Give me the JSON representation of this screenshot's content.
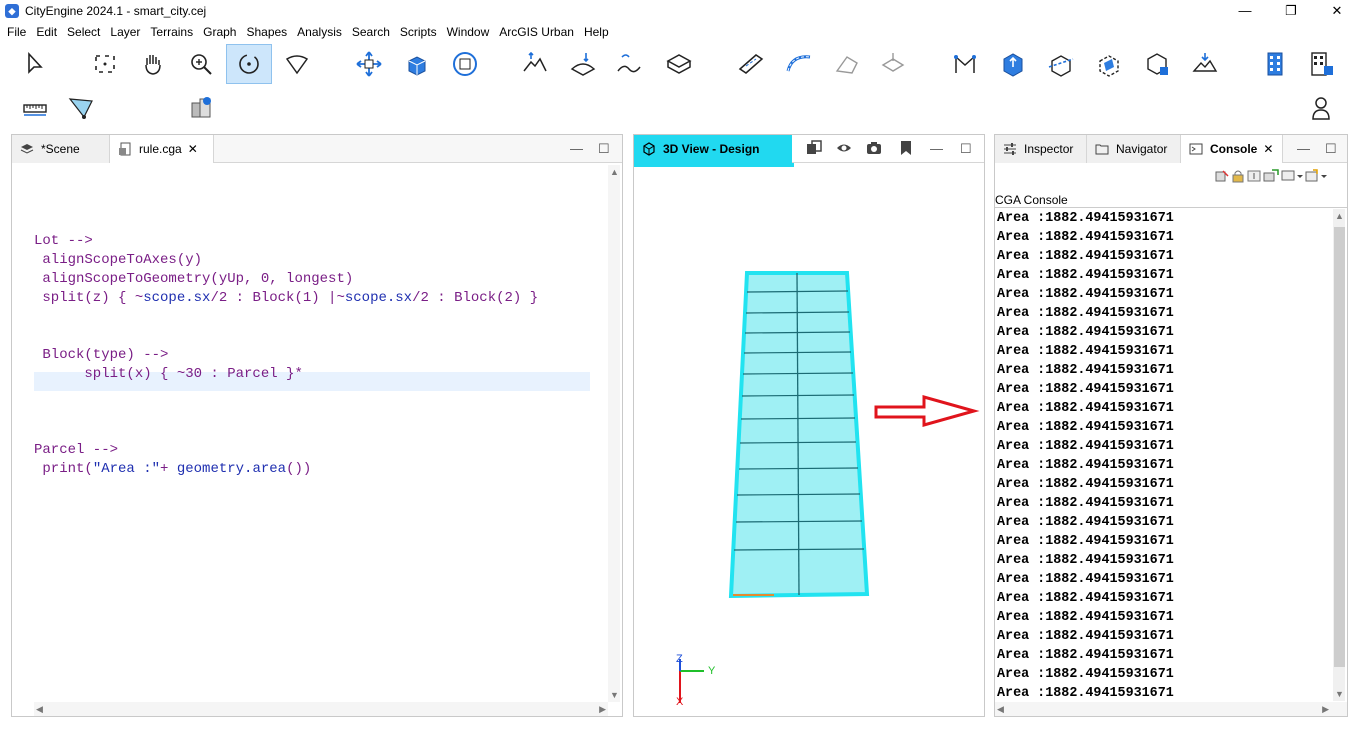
{
  "window": {
    "title": "CityEngine 2024.1 - smart_city.cej",
    "minimize": "—",
    "maximize": "❐",
    "close": "✕"
  },
  "menu": [
    "File",
    "Edit",
    "Select",
    "Layer",
    "Terrains",
    "Graph",
    "Shapes",
    "Analysis",
    "Search",
    "Scripts",
    "Window",
    "ArcGIS Urban",
    "Help"
  ],
  "editor": {
    "tabs": [
      {
        "label": "*Scene",
        "icon": "layers-icon"
      },
      {
        "label": "rule.cga",
        "icon": "rule-file-icon"
      }
    ],
    "code": [
      [
        {
          "t": "",
          "c": "k-dark"
        }
      ],
      [
        {
          "t": "Lot -->",
          "c": "k-purple"
        }
      ],
      [
        {
          "t": " alignScopeToAxes(y)",
          "c": "k-purple"
        }
      ],
      [
        {
          "t": " alignScopeToGeometry(yUp, 0, longest)",
          "c": "k-purple"
        }
      ],
      [
        {
          "t": " split(z) { ~",
          "c": "k-purple"
        },
        {
          "t": "scope.sx",
          "c": "k-blue"
        },
        {
          "t": "/2 : Block(1) |~",
          "c": "k-purple"
        },
        {
          "t": "scope.sx",
          "c": "k-blue"
        },
        {
          "t": "/2 : Block(2) }",
          "c": "k-purple"
        }
      ],
      [
        {
          "t": "",
          "c": "k-dark"
        }
      ],
      [
        {
          "t": "",
          "c": "k-dark"
        }
      ],
      [
        {
          "t": " Block(type) -->",
          "c": "k-purple"
        }
      ],
      [
        {
          "t": "      split(x) { ~30 : Parcel }*",
          "c": "k-purple"
        }
      ],
      [
        {
          "t": "",
          "c": "k-dark"
        }
      ],
      [
        {
          "t": "",
          "c": "k-dark"
        }
      ],
      [
        {
          "t": "",
          "c": "k-dark"
        }
      ],
      [
        {
          "t": "Parcel -->",
          "c": "k-purple"
        }
      ],
      [
        {
          "t": " print(",
          "c": "k-purple"
        },
        {
          "t": "\"Area :\"",
          "c": "k-blue"
        },
        {
          "t": "+ ",
          "c": "k-purple"
        },
        {
          "t": "geometry.area",
          "c": "k-blue"
        },
        {
          "t": "())",
          "c": "k-purple"
        }
      ]
    ]
  },
  "view3d": {
    "tab": "3D View - Design",
    "axis_z": "Z",
    "axis_y": "Y",
    "axis_x": "X"
  },
  "console": {
    "tabs": [
      {
        "label": "Inspector",
        "icon": "sliders-icon"
      },
      {
        "label": "Navigator",
        "icon": "folder-icon"
      },
      {
        "label": "Console",
        "icon": "console-icon"
      }
    ],
    "header": "CGA Console",
    "lines": [
      "Area :1882.49415931671",
      "Area :1882.49415931671",
      "Area :1882.49415931671",
      "Area :1882.49415931671",
      "Area :1882.49415931671",
      "Area :1882.49415931671",
      "Area :1882.49415931671",
      "Area :1882.49415931671",
      "Area :1882.49415931671",
      "Area :1882.49415931671",
      "Area :1882.49415931671",
      "Area :1882.49415931671",
      "Area :1882.49415931671",
      "Area :1882.49415931671",
      "Area :1882.49415931671",
      "Area :1882.49415931671",
      "Area :1882.49415931671",
      "Area :1882.49415931671",
      "Area :1882.49415931671",
      "Area :1882.49415931671",
      "Area :1882.49415931671",
      "Area :1882.49415931671",
      "Area :1882.49415931671",
      "Area :1882.49415931671",
      "Area :1882.49415931671",
      "Area :1882.49415931671"
    ]
  },
  "colors": {
    "accent_cyan": "#21d9f0",
    "arrow_red": "#e0141c"
  }
}
